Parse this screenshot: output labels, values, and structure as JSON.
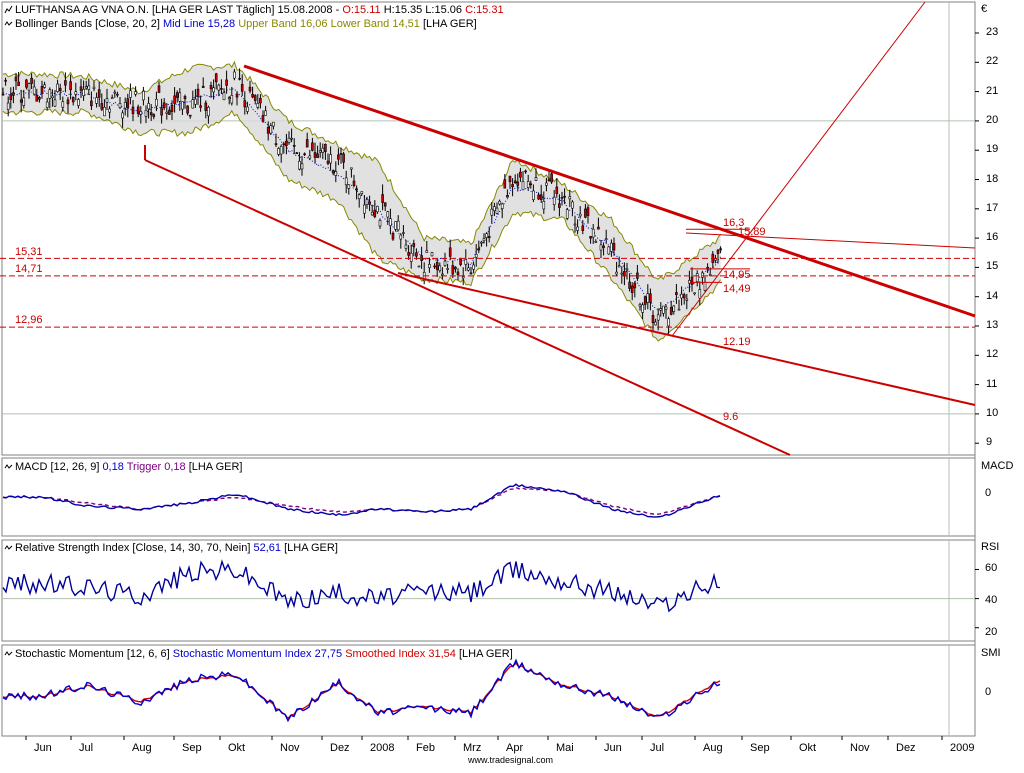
{
  "main": {
    "header": {
      "symbol": "LUFTHANSA AG VNA O.N.",
      "meta": "[LHA GER LAST Täglich] 15.08.2008 - ",
      "open": "O:15.11",
      "high": "H:15.35",
      "low": "L:15.06",
      "close": "C:15.31"
    },
    "bb_header": {
      "name": "Bollinger Bands [Close, 20, 2]",
      "mid": "Mid Line 15,28",
      "upper": "Upper Band 16,06",
      "lower": "Lower Band 14,51",
      "suffix": "[LHA GER]"
    },
    "currency": "€",
    "y_ticks": [
      "23",
      "22",
      "21",
      "20",
      "19",
      "18",
      "17",
      "16",
      "15",
      "14",
      "13",
      "12",
      "11",
      "10",
      "9"
    ],
    "levels": {
      "l1531": "15,31",
      "l1471": "14,71",
      "l1296": "12,96",
      "l163": "16,3",
      "l1589": "15,89",
      "l1495": "14,95",
      "l1449": "14,49",
      "l1219": "12.19",
      "l96": "9.6"
    }
  },
  "macd": {
    "name": "MACD [12, 26, 9]",
    "value": "0,18",
    "trigger": "Trigger 0,18",
    "suffix": "[LHA GER]",
    "axis_label": "MACD",
    "zero": "0"
  },
  "rsi": {
    "name": "Relative Strength Index [Close, 14, 30, 70, Nein]",
    "value": "52,61",
    "suffix": "[LHA GER]",
    "axis_label": "RSI",
    "ticks": [
      "60",
      "40",
      "20"
    ]
  },
  "smi": {
    "name": "Stochastic Momentum [12, 6, 6]",
    "index": "Stochastic Momentum Index 27,75",
    "smoothed": "Smoothed Index 31,54",
    "suffix": "[LHA GER]",
    "axis_label": "SMI",
    "zero": "0"
  },
  "x_axis": [
    "Jun",
    "Jul",
    "Aug",
    "Sep",
    "Okt",
    "Nov",
    "Dez",
    "2008",
    "Feb",
    "Mrz",
    "Apr",
    "Mai",
    "Jun",
    "Jul",
    "Aug",
    "Sep",
    "Okt",
    "Nov",
    "Dez",
    "2009"
  ],
  "footer": "www.tradesignal.com",
  "colors": {
    "price_up": "#000000",
    "bands": "#888800",
    "band_fill": "#d9d9d9",
    "midline": "#0000cc",
    "trend": "#cc0000",
    "macd": "#0000aa",
    "trigger": "#800080",
    "rsi": "#000099",
    "smi": "#0000cc",
    "smi_smooth": "#cc0000"
  },
  "chart_data": [
    {
      "type": "line",
      "title": "LUFTHANSA AG VNA O.N.",
      "ylabel": "€",
      "ylim": [
        8.6,
        23.6
      ],
      "x": [
        "Jun",
        "Jul",
        "Aug",
        "Sep",
        "Okt",
        "Nov",
        "Dez",
        "2008",
        "Feb",
        "Mrz",
        "Apr",
        "Mai",
        "Jun",
        "Jul",
        "Aug"
      ],
      "series": [
        {
          "name": "Close",
          "values": [
            21.0,
            20.9,
            20.6,
            20.5,
            21.3,
            19.0,
            18.6,
            17.0,
            15.2,
            15.0,
            18.2,
            17.3,
            15.5,
            13.2,
            15.31
          ]
        },
        {
          "name": "Upper Band 16,06",
          "values": [
            21.6,
            21.5,
            21.0,
            21.8,
            21.9,
            20.0,
            19.2,
            18.6,
            16.0,
            15.8,
            18.7,
            17.8,
            16.6,
            14.5,
            16.06
          ]
        },
        {
          "name": "Lower Band 14,51",
          "values": [
            20.3,
            20.3,
            19.6,
            19.6,
            20.3,
            18.0,
            17.3,
            15.3,
            14.6,
            14.5,
            16.9,
            16.6,
            14.6,
            12.5,
            14.51
          ]
        }
      ],
      "annotations": [
        "15,31",
        "14,71",
        "12,96",
        "16,3",
        "15,89",
        "14,95",
        "14,49",
        "12.19",
        "9.6"
      ]
    },
    {
      "type": "line",
      "title": "MACD [12, 26, 9]",
      "x": [
        "Jun",
        "Jul",
        "Aug",
        "Sep",
        "Okt",
        "Nov",
        "Dez",
        "2008",
        "Feb",
        "Mrz",
        "Apr",
        "Mai",
        "Jun",
        "Jul",
        "Aug"
      ],
      "series": [
        {
          "name": "MACD",
          "values": [
            0.1,
            -0.2,
            -0.3,
            -0.1,
            0.2,
            -0.3,
            -0.5,
            -0.3,
            -0.4,
            -0.3,
            0.5,
            0.3,
            -0.3,
            -0.6,
            0.18
          ]
        },
        {
          "name": "Trigger",
          "values": [
            0.1,
            -0.1,
            -0.3,
            -0.1,
            0.1,
            -0.2,
            -0.4,
            -0.3,
            -0.4,
            -0.3,
            0.4,
            0.3,
            -0.2,
            -0.5,
            0.18
          ]
        }
      ]
    },
    {
      "type": "line",
      "title": "Relative Strength Index [Close, 14, 30, 70, Nein]",
      "ylim": [
        15,
        72
      ],
      "x": [
        "Jun",
        "Jul",
        "Aug",
        "Sep",
        "Okt",
        "Nov",
        "Dez",
        "2008",
        "Feb",
        "Mrz",
        "Apr",
        "Mai",
        "Jun",
        "Jul",
        "Aug"
      ],
      "series": [
        {
          "name": "RSI",
          "values": [
            50,
            48,
            42,
            58,
            60,
            38,
            44,
            40,
            45,
            44,
            60,
            52,
            45,
            35,
            52.61
          ]
        }
      ]
    },
    {
      "type": "line",
      "title": "Stochastic Momentum [12, 6, 6]",
      "x": [
        "Jun",
        "Jul",
        "Aug",
        "Sep",
        "Okt",
        "Nov",
        "Dez",
        "2008",
        "Feb",
        "Mrz",
        "Apr",
        "Mai",
        "Jun",
        "Jul",
        "Aug"
      ],
      "series": [
        {
          "name": "Stochastic Momentum Index",
          "values": [
            0,
            20,
            -10,
            30,
            40,
            -40,
            25,
            -30,
            -20,
            -30,
            60,
            20,
            0,
            -40,
            27.75
          ]
        },
        {
          "name": "Smoothed Index",
          "values": [
            0,
            18,
            -8,
            28,
            38,
            -38,
            23,
            -28,
            -18,
            -28,
            58,
            20,
            0,
            -38,
            31.54
          ]
        }
      ]
    }
  ]
}
